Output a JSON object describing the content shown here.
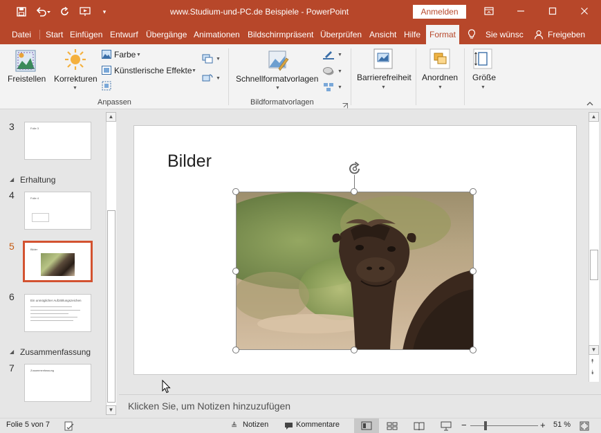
{
  "window": {
    "title": "www.Studium-und-PC.de  Beispiele  -  PowerPoint",
    "sign_in": "Anmelden"
  },
  "tabs": [
    "Datei",
    "Start",
    "Einfügen",
    "Entwurf",
    "Übergänge",
    "Animationen",
    "Bildschirmpräsent",
    "Überprüfen",
    "Ansicht",
    "Hilfe",
    "Format"
  ],
  "active_tab": "Format",
  "tell_me": "Sie wünsc",
  "share": "Freigeben",
  "ribbon": {
    "remove_background": "Freistellen",
    "corrections": "Korrekturen",
    "color": "Farbe",
    "artistic_effects": "Künstlerische Effekte",
    "adjust_group": "Anpassen",
    "quick_styles": "Schnellformatvorlagen",
    "styles_group": "Bildformatvorlagen",
    "accessibility": "Barrierefreiheit",
    "arrange": "Anordnen",
    "size": "Größe"
  },
  "thumbnails": {
    "sections": [
      "Erhaltung",
      "Zusammenfassung"
    ],
    "slides": [
      {
        "number": "3",
        "mini_title": "Folie 3"
      },
      {
        "number": "4",
        "mini_title": "Folie 4"
      },
      {
        "number": "5",
        "mini_title": "Bilder"
      },
      {
        "number": "6",
        "mini_title": "Ein unmöglicher Aufzählungszeichen"
      },
      {
        "number": "7",
        "mini_title": "Zusammenfassung"
      }
    ]
  },
  "slide": {
    "title": "Bilder"
  },
  "notes_placeholder": "Klicken Sie, um Notizen hinzuzufügen",
  "status": {
    "slide_counter": "Folie 5 von 7",
    "notes": "Notizen",
    "comments": "Kommentare",
    "zoom": "51 %",
    "zoom_level": 0.51
  },
  "colors": {
    "accent": "#b7472a",
    "active_thumb": "#d35230"
  }
}
